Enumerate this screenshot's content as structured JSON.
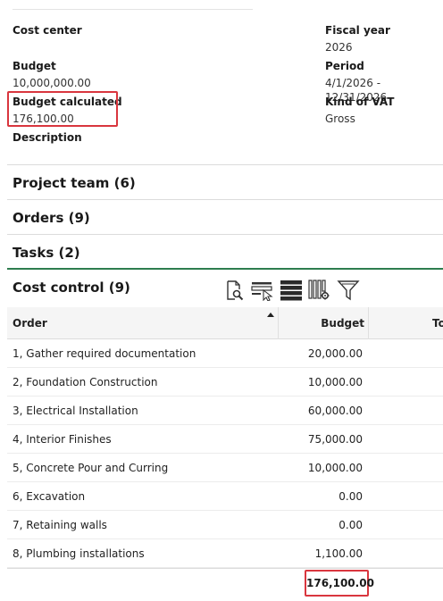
{
  "fields": {
    "cost_center": {
      "label": "Cost center",
      "value": ""
    },
    "fiscal_year": {
      "label": "Fiscal year",
      "value": "2026"
    },
    "budget": {
      "label": "Budget",
      "value": "10,000,000.00"
    },
    "period": {
      "label": "Period",
      "value": "4/1/2026 - 12/31/2026"
    },
    "budget_calculated": {
      "label": "Budget calculated",
      "value": "176,100.00"
    },
    "kind_of_vat": {
      "label": "Kind of VAT",
      "value": "Gross"
    },
    "description": {
      "label": "Description",
      "value": ""
    }
  },
  "sections": {
    "project_team": "Project team (6)",
    "orders": "Orders (9)",
    "tasks": "Tasks (2)",
    "cost_control": "Cost control (9)"
  },
  "toolbar": {
    "icons": [
      "search-document-icon",
      "select-row-icon",
      "rows-icon",
      "column-settings-icon",
      "filter-icon"
    ]
  },
  "table": {
    "columns": [
      "Order",
      "Budget",
      "To"
    ],
    "rows": [
      {
        "order": "1, Gather required documentation",
        "budget": "20,000.00"
      },
      {
        "order": "2, Foundation Construction",
        "budget": "10,000.00"
      },
      {
        "order": "3, Electrical Installation",
        "budget": "60,000.00"
      },
      {
        "order": "4, Interior Finishes",
        "budget": "75,000.00"
      },
      {
        "order": "5, Concrete Pour and Curring",
        "budget": "10,000.00"
      },
      {
        "order": "6, Excavation",
        "budget": "0.00"
      },
      {
        "order": "7, Retaining walls",
        "budget": "0.00"
      },
      {
        "order": "8, Plumbing installations",
        "budget": "1,100.00"
      }
    ],
    "total": "176,100.00"
  },
  "colors": {
    "highlight": "#d9363e",
    "section_accent": "#2e7d4f"
  }
}
